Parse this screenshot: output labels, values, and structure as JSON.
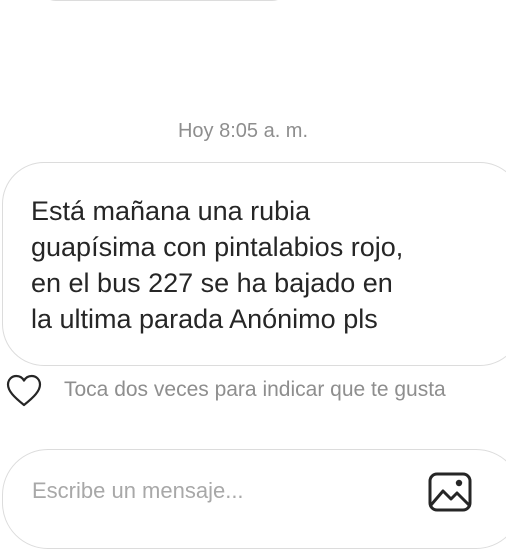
{
  "chat": {
    "timestamp": "Hoy 8:05 a. m.",
    "message": {
      "text": "Está mañana una rubia\nguapísima con pintalabios rojo,\nen el bus 227 se ha bajado en\nla ultima parada Anónimo pls"
    },
    "like_hint": "Toca dos veces para indicar que te gusta"
  },
  "composer": {
    "placeholder": "Escribe un mensaje...",
    "value": ""
  },
  "icons": {
    "like": "heart-icon",
    "attach": "image-icon"
  },
  "colors": {
    "text_primary": "#262626",
    "text_secondary": "#8e8e8e",
    "border": "#dcdcdc"
  }
}
